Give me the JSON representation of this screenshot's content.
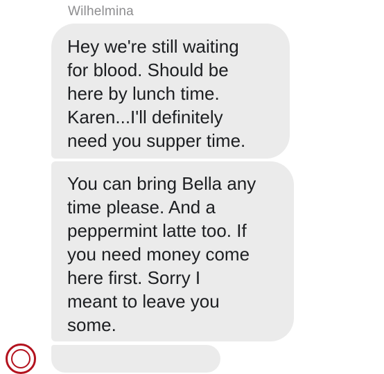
{
  "conversation": {
    "sender": "Wilhelmina",
    "messages": [
      {
        "text": "Hey we're still waiting\nfor blood. Should be\nhere by lunch time.\nKaren...I'll definitely\nneed you supper time."
      },
      {
        "text": "You can bring Bella any\ntime please. And a\npeppermint latte too. If\nyou need money come\nhere first. Sorry I\nmeant to leave you\nsome."
      },
      {
        "text": ""
      }
    ]
  },
  "colors": {
    "bubble_background": "#ebebeb",
    "message_text": "#1c1e21",
    "sender_name": "#8d8d8f",
    "avatar_accent": "#b3121e"
  }
}
